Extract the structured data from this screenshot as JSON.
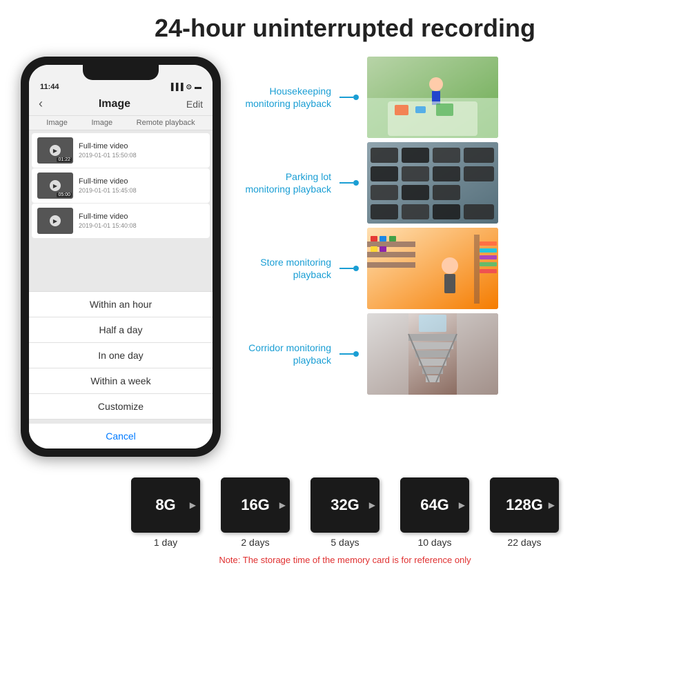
{
  "title": "24-hour uninterrupted recording",
  "phone": {
    "time": "11:44",
    "nav_title": "Image",
    "nav_edit": "Edit",
    "nav_back": "‹",
    "tabs": [
      "Image",
      "Image",
      "Remote playback"
    ],
    "videos": [
      {
        "title": "Full-time video",
        "date": "2019-01-01 15:50:08",
        "duration": "01:22"
      },
      {
        "title": "Full-time video",
        "date": "2019-01-01 15:45:08",
        "duration": "05:00"
      },
      {
        "title": "Full-time video",
        "date": "2019-01-01 15:40:08",
        "duration": ""
      }
    ],
    "sheet_options": [
      "Within an hour",
      "Half a day",
      "In one day",
      "Within a week",
      "Customize"
    ],
    "sheet_cancel": "Cancel"
  },
  "monitoring": [
    {
      "label": "Housekeeping\nmonitoring playback",
      "img_type": "housekeeping"
    },
    {
      "label": "Parking lot\nmonitoring playback",
      "img_type": "parking"
    },
    {
      "label": "Store monitoring\nplayback",
      "img_type": "store"
    },
    {
      "label": "Corridor monitoring\nplayback",
      "img_type": "corridor"
    }
  ],
  "sd_cards": [
    {
      "size": "8G",
      "days": "1 day"
    },
    {
      "size": "16G",
      "days": "2 days"
    },
    {
      "size": "32G",
      "days": "5 days"
    },
    {
      "size": "64G",
      "days": "10 days"
    },
    {
      "size": "128G",
      "days": "22 days"
    }
  ],
  "note": "Note: The storage time of the memory card is for reference only"
}
